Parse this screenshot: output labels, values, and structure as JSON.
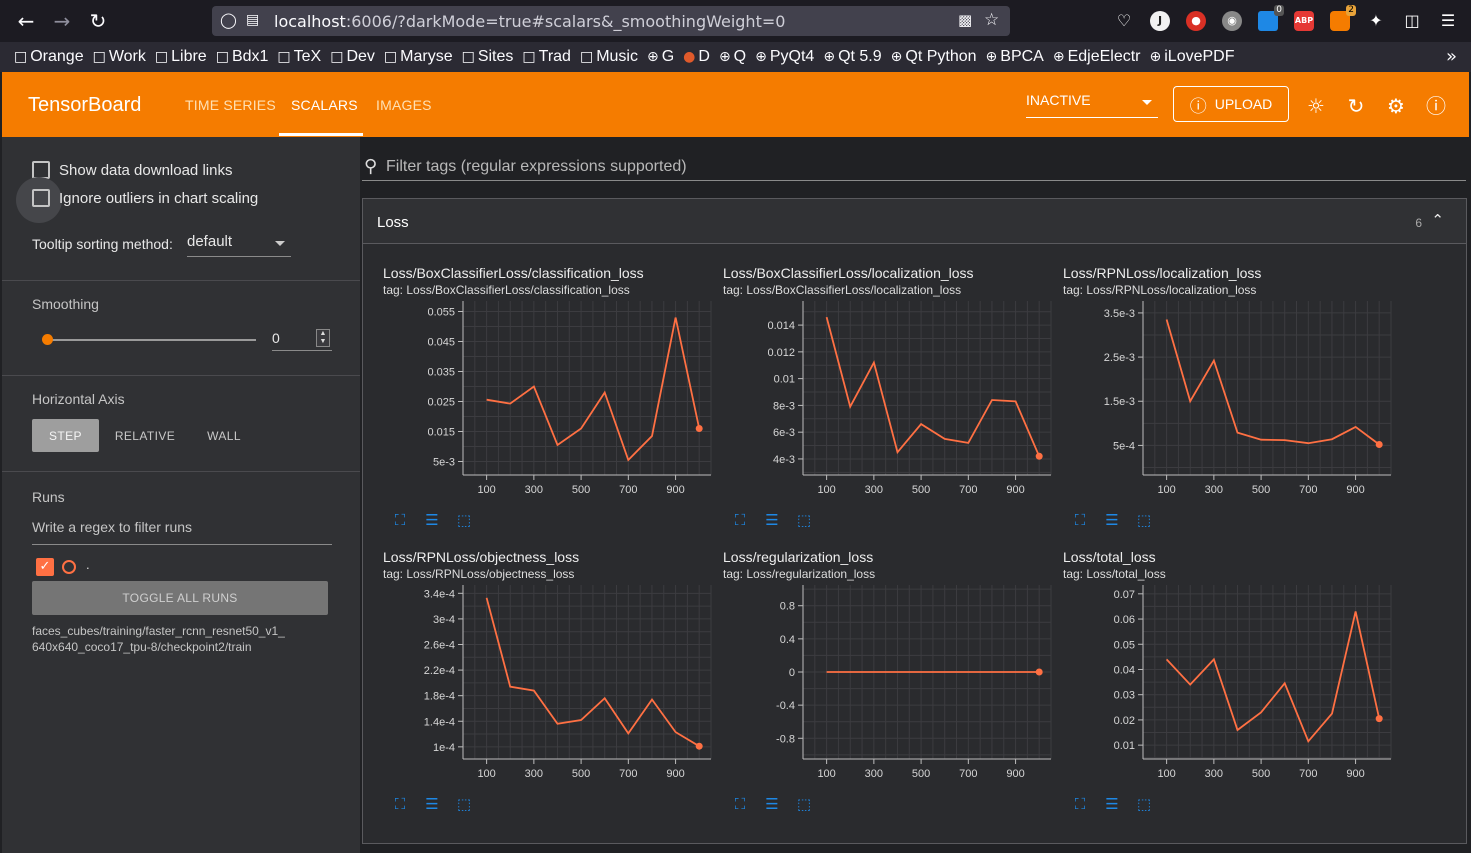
{
  "browser": {
    "url_host": "localhost",
    "url_rest": ":6006/?darkMode=true#scalars&_smoothingWeight=0",
    "bookmarks": [
      {
        "icon": "folder-icon",
        "label": "Orange"
      },
      {
        "icon": "folder-icon",
        "label": "Work"
      },
      {
        "icon": "folder-icon",
        "label": "Libre"
      },
      {
        "icon": "folder-icon",
        "label": "Bdx1"
      },
      {
        "icon": "folder-icon",
        "label": "TeX"
      },
      {
        "icon": "folder-icon",
        "label": "Dev"
      },
      {
        "icon": "folder-icon",
        "label": "Maryse"
      },
      {
        "icon": "folder-icon",
        "label": "Sites"
      },
      {
        "icon": "folder-icon",
        "label": "Trad"
      },
      {
        "icon": "folder-icon",
        "label": "Music"
      },
      {
        "icon": "globe-icon",
        "label": "G"
      },
      {
        "icon": "duckduckgo-icon",
        "label": "D"
      },
      {
        "icon": "globe-icon",
        "label": "Q"
      },
      {
        "icon": "globe-icon",
        "label": "PyQt4"
      },
      {
        "icon": "globe-icon",
        "label": "Qt 5.9"
      },
      {
        "icon": "globe-icon",
        "label": "Qt Python"
      },
      {
        "icon": "globe-icon",
        "label": "BPCA"
      },
      {
        "icon": "globe-icon",
        "label": "EdjeElectr"
      },
      {
        "icon": "globe-icon",
        "label": "iLovePDF"
      }
    ],
    "ext_badges": {
      "counter_a": "0",
      "abp": "ABP",
      "counter_b": "2",
      "jlabel": "J"
    }
  },
  "header": {
    "brand": "TensorBoard",
    "tabs": [
      "TIME SERIES",
      "SCALARS",
      "IMAGES"
    ],
    "active_tab": "SCALARS",
    "run_selector": "INACTIVE",
    "upload": "UPLOAD",
    "accent": "#f57c00"
  },
  "sidebar": {
    "show_download": "Show data download links",
    "ignore_outliers": "Ignore outliers in chart scaling",
    "tooltip_label": "Tooltip sorting method:",
    "tooltip_value": "default",
    "smoothing_label": "Smoothing",
    "smoothing_value": "0",
    "smoothing_level": 0,
    "haxis_label": "Horizontal Axis",
    "haxis_options": [
      "STEP",
      "RELATIVE",
      "WALL"
    ],
    "haxis_selected": "STEP",
    "runs_label": "Runs",
    "runs_filter_placeholder": "Write a regex to filter runs",
    "run_name": ".",
    "toggle_all": "TOGGLE ALL RUNS",
    "run_path_1": "faces_cubes/training/faster_rcnn_resnet50_v1_",
    "run_path_2": "640x640_coco17_tpu-8/checkpoint2/train"
  },
  "main": {
    "filter_placeholder": "Filter tags (regular expressions supported)",
    "group_title": "Loss",
    "group_count": "6"
  },
  "chart_data": [
    {
      "type": "line",
      "title": "Loss/BoxClassifierLoss/classification_loss",
      "tag": "tag: Loss/BoxClassifierLoss/classification_loss",
      "x": [
        100,
        200,
        300,
        400,
        500,
        600,
        700,
        800,
        900,
        1000
      ],
      "values": [
        0.0256,
        0.0243,
        0.03,
        0.0105,
        0.016,
        0.028,
        0.0055,
        0.0135,
        0.053,
        0.016
      ],
      "ylim": [
        0.0005,
        0.0585
      ],
      "yticks": [
        0.005,
        0.015,
        0.025,
        0.035,
        0.045,
        0.055
      ],
      "yticklabels": [
        "5e-3",
        "0.015",
        "0.025",
        "0.035",
        "0.045",
        "0.055"
      ],
      "xlim": [
        0,
        1050
      ],
      "xticks": [
        100,
        300,
        500,
        700,
        900
      ],
      "xticklabels": [
        "100",
        "300",
        "500",
        "700",
        "900"
      ],
      "color": "#ff7043"
    },
    {
      "type": "line",
      "title": "Loss/BoxClassifierLoss/localization_loss",
      "tag": "tag: Loss/BoxClassifierLoss/localization_loss",
      "x": [
        100,
        200,
        300,
        400,
        500,
        600,
        700,
        800,
        900,
        1000
      ],
      "values": [
        0.0146,
        0.0079,
        0.0112,
        0.0045,
        0.0066,
        0.0055,
        0.0052,
        0.0084,
        0.0083,
        0.0042
      ],
      "ylim": [
        0.0028,
        0.0158
      ],
      "yticks": [
        0.004,
        0.006,
        0.008,
        0.01,
        0.012,
        0.014
      ],
      "yticklabels": [
        "4e-3",
        "6e-3",
        "8e-3",
        "0.01",
        "0.012",
        "0.014"
      ],
      "xlim": [
        0,
        1050
      ],
      "xticks": [
        100,
        300,
        500,
        700,
        900
      ],
      "xticklabels": [
        "100",
        "300",
        "500",
        "700",
        "900"
      ],
      "color": "#ff7043"
    },
    {
      "type": "line",
      "title": "Loss/RPNLoss/localization_loss",
      "tag": "tag: Loss/RPNLoss/localization_loss",
      "x": [
        100,
        200,
        300,
        400,
        500,
        600,
        700,
        800,
        900,
        1000
      ],
      "values": [
        0.00335,
        0.0015,
        0.00242,
        0.00079,
        0.00063,
        0.00062,
        0.00055,
        0.00064,
        0.00092,
        0.00052
      ],
      "ylim": [
        -0.00017,
        0.00377
      ],
      "yticks": [
        0.0005,
        0.0015,
        0.0025,
        0.0035
      ],
      "yticklabels": [
        "5e-4",
        "1.5e-3",
        "2.5e-3",
        "3.5e-3"
      ],
      "xlim": [
        0,
        1050
      ],
      "xticks": [
        100,
        300,
        500,
        700,
        900
      ],
      "xticklabels": [
        "100",
        "300",
        "500",
        "700",
        "900"
      ],
      "color": "#ff7043"
    },
    {
      "type": "line",
      "title": "Loss/RPNLoss/objectness_loss",
      "tag": "tag: Loss/RPNLoss/objectness_loss",
      "x": [
        100,
        200,
        300,
        400,
        500,
        600,
        700,
        800,
        900,
        1000
      ],
      "values": [
        0.000333,
        0.000194,
        0.000188,
        0.000136,
        0.000142,
        0.000176,
        0.000121,
        0.000174,
        0.000123,
        0.000101
      ],
      "ylim": [
        8.1e-05,
        0.000353
      ],
      "yticks": [
        0.0001,
        0.00014,
        0.00018,
        0.00022,
        0.00026,
        0.0003,
        0.00034
      ],
      "yticklabels": [
        "1e-4",
        "1.4e-4",
        "1.8e-4",
        "2.2e-4",
        "2.6e-4",
        "3e-4",
        "3.4e-4"
      ],
      "xlim": [
        0,
        1050
      ],
      "xticks": [
        100,
        300,
        500,
        700,
        900
      ],
      "xticklabels": [
        "100",
        "300",
        "500",
        "700",
        "900"
      ],
      "color": "#ff7043"
    },
    {
      "type": "line",
      "title": "Loss/regularization_loss",
      "tag": "tag: Loss/regularization_loss",
      "x": [
        100,
        200,
        300,
        400,
        500,
        600,
        700,
        800,
        900,
        1000
      ],
      "values": [
        0,
        0,
        0,
        0,
        0,
        0,
        0,
        0,
        0,
        0
      ],
      "ylim": [
        -1.05,
        1.05
      ],
      "yticks": [
        -0.8,
        -0.4,
        0,
        0.4,
        0.8
      ],
      "yticklabels": [
        "-0.8",
        "-0.4",
        "0",
        "0.4",
        "0.8"
      ],
      "xlim": [
        0,
        1050
      ],
      "xticks": [
        100,
        300,
        500,
        700,
        900
      ],
      "xticklabels": [
        "100",
        "300",
        "500",
        "700",
        "900"
      ],
      "color": "#ff7043"
    },
    {
      "type": "line",
      "title": "Loss/total_loss",
      "tag": "tag: Loss/total_loss",
      "x": [
        100,
        200,
        300,
        400,
        500,
        600,
        700,
        800,
        900,
        1000
      ],
      "values": [
        0.044,
        0.034,
        0.044,
        0.016,
        0.023,
        0.0345,
        0.0115,
        0.0225,
        0.063,
        0.0205
      ],
      "ylim": [
        0.0045,
        0.0735
      ],
      "yticks": [
        0.01,
        0.02,
        0.03,
        0.04,
        0.05,
        0.06,
        0.07
      ],
      "yticklabels": [
        "0.01",
        "0.02",
        "0.03",
        "0.04",
        "0.05",
        "0.06",
        "0.07"
      ],
      "xlim": [
        0,
        1050
      ],
      "xticks": [
        100,
        300,
        500,
        700,
        900
      ],
      "xticklabels": [
        "100",
        "300",
        "500",
        "700",
        "900"
      ],
      "color": "#ff7043"
    }
  ]
}
